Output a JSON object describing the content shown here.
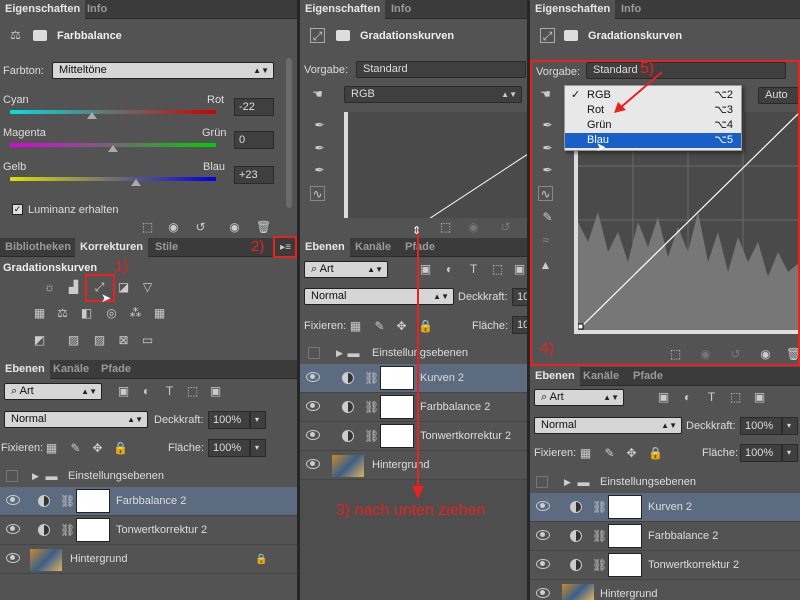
{
  "left": {
    "tabs": [
      "Eigenschaften",
      "Info"
    ],
    "title": "Farbbalance",
    "farbton_label": "Farbton:",
    "farbton_value": "Mitteltöne",
    "sliders": [
      {
        "left": "Cyan",
        "right": "Rot",
        "value": "-22",
        "level": 0.39
      },
      {
        "left": "Magenta",
        "right": "Grün",
        "value": "0",
        "level": 0.5
      },
      {
        "left": "Gelb",
        "right": "Blau",
        "value": "+23",
        "level": 0.61
      }
    ],
    "luminanz": "Luminanz erhalten",
    "tabs2": [
      "Bibliotheken",
      "Korrekturen",
      "Stile"
    ],
    "korr_title": "Gradationskurven",
    "layers_tabs": [
      "Ebenen",
      "Kanäle",
      "Pfade"
    ],
    "art": "Art",
    "mode": "Normal",
    "deckkraft_label": "Deckkraft:",
    "deckkraft": "100%",
    "fixieren": "Fixieren:",
    "flaeche_label": "Fläche:",
    "flaeche": "100%",
    "group": "Einstellungsebenen",
    "layers": [
      "Farbbalance 2",
      "Tonwertkorrektur 2",
      "Hintergrund"
    ],
    "anno1": "1)",
    "anno2": "2)"
  },
  "middle": {
    "tabs": [
      "Eigenschaften",
      "Info"
    ],
    "title": "Gradationskurven",
    "vorgabe_label": "Vorgabe:",
    "vorgabe": "Standard",
    "channel": "RGB",
    "layers_tabs": [
      "Ebenen",
      "Kanäle",
      "Pfade"
    ],
    "art": "Art",
    "mode": "Normal",
    "deckkraft_label": "Deckkraft:",
    "deckkraft": "10",
    "fixieren": "Fixieren:",
    "flaeche_label": "Fläche:",
    "flaeche": "10",
    "group": "Einstellungsebenen",
    "layers": [
      "Kurven 2",
      "Farbbalance 2",
      "Tonwertkorrektur 2",
      "Hintergrund"
    ],
    "anno3": "3) nach unten ziehen"
  },
  "right": {
    "tabs": [
      "Eigenschaften",
      "Info"
    ],
    "title": "Gradationskurven",
    "vorgabe_label": "Vorgabe:",
    "vorgabe": "Standard",
    "auto": "Auto",
    "menu": [
      {
        "check": "✓",
        "label": "RGB",
        "sc": "⌥2"
      },
      {
        "check": "",
        "label": "Rot",
        "sc": "⌥3"
      },
      {
        "check": "",
        "label": "Grün",
        "sc": "⌥4"
      },
      {
        "check": "",
        "label": "Blau",
        "sc": "⌥5"
      }
    ],
    "layers_tabs": [
      "Ebenen",
      "Kanäle",
      "Pfade"
    ],
    "art": "Art",
    "mode": "Normal",
    "deckkraft_label": "Deckkraft:",
    "deckkraft": "100%",
    "fixieren": "Fixieren:",
    "flaeche_label": "Fläche:",
    "flaeche": "100%",
    "group": "Einstellungsebenen",
    "layers": [
      "Kurven 2",
      "Farbbalance 2",
      "Tonwertkorrektur 2",
      "Hintergrund"
    ],
    "anno4": "4)",
    "anno5": "5)"
  },
  "colors": {
    "accent": "#e8221e",
    "selected": "#5c6b80",
    "menu_highlight": "#1a5fc8"
  }
}
